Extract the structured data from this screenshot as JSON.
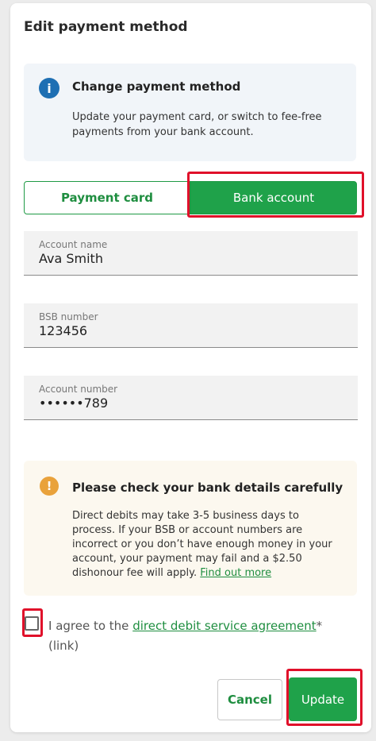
{
  "dialog": {
    "title": "Edit payment method"
  },
  "info": {
    "icon": "info-icon",
    "heading": "Change payment method",
    "body": "Update your payment card, or switch to fee-free payments from your bank account."
  },
  "toggle": {
    "options": [
      "Payment card",
      "Bank account"
    ],
    "selected": "Bank account"
  },
  "fields": [
    {
      "label": "Account name",
      "value": "Ava Smith"
    },
    {
      "label": "BSB number",
      "value": "123456"
    },
    {
      "label": "Account number",
      "value": "••••••789"
    }
  ],
  "warning": {
    "icon": "warning-icon",
    "heading": "Please check your bank details carefully",
    "body": "Direct debits may take 3-5 business days to process. If your BSB or account numbers are incorrect or you don’t have enough money in your account, your payment may fail and a $2.50 dishonour fee will apply.",
    "link_text": "Find out more"
  },
  "agreement": {
    "prefix": "I agree to the ",
    "link_text": "direct debit service agreement",
    "suffix": "* (link)",
    "checked": false
  },
  "buttons": {
    "cancel": "Cancel",
    "update": "Update"
  },
  "colors": {
    "primary_green": "#1fa24a",
    "highlight_red": "#e0102a",
    "info_blue": "#1e6fb3",
    "warning_orange": "#e9a23b"
  }
}
